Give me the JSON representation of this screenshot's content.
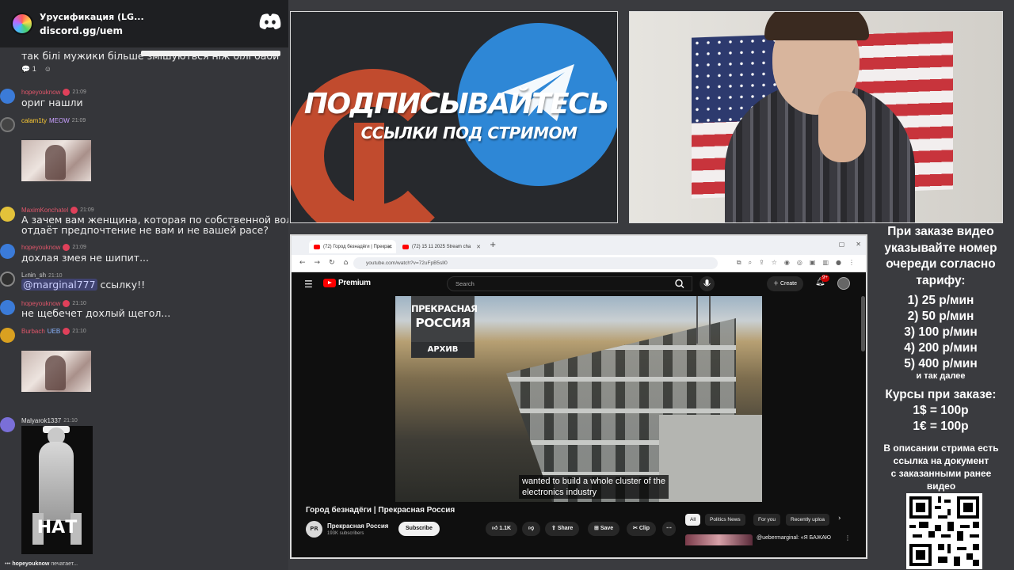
{
  "discord": {
    "server_title": "Урусификация (LG...",
    "invite": "discord.gg/uem"
  },
  "chat": {
    "messages": [
      {
        "text": "так білі мужики більше змішуються ніж білі баби",
        "reactions": [
          {
            "emoji": "speech-bubble",
            "count": "1"
          }
        ]
      },
      {
        "user": "hopeyouknow",
        "time": "21:09",
        "text": "ориг нашли"
      },
      {
        "user": "calam1ty",
        "badge": "MEOW",
        "time": "21:09",
        "image": "woman-photo"
      },
      {
        "user": "MaximKonchatel",
        "time": "21:09",
        "text_line1": "А зачем вам женщина, которая по собственной воле",
        "text_line2": "отдаёт предпочтение не вам и не вашей расе?"
      },
      {
        "user": "hopeyouknow",
        "time": "21:09",
        "text": "дохлая змея не шипит..."
      },
      {
        "user": "L𝔢nin_sh",
        "time": "21:10",
        "mention": "@marginal777",
        "text": " ссылку!!"
      },
      {
        "user": "hopeyouknow",
        "time": "21:10",
        "text": "не щебечет дохлый щегол..."
      },
      {
        "user": "Burbach",
        "badge": "UEB",
        "time": "21:10",
        "image": "woman-photo"
      },
      {
        "user": "Malyarok1337",
        "time": "21:10",
        "gif_caption": "НАТ"
      }
    ],
    "typing_user": "hopeyouknow",
    "typing_text": " печатает..."
  },
  "banner": {
    "title": "ПОДПИСЫВАЙТЕСЬ",
    "subtitle": "ССЫЛКИ ПОД СТРИМОМ"
  },
  "browser": {
    "tabs": [
      {
        "label": "(72) Город безнадёги | Прекрас",
        "active": true
      },
      {
        "label": "(72) 15 11 2025 Stream cha",
        "active": false
      }
    ],
    "url": "youtube.com/watch?v=72uFpB5sll0",
    "youtube": {
      "brand": "Premium",
      "search_placeholder": "Search",
      "create_label": "Create",
      "notifications": "9+",
      "logo_line1": "ПРЕКРАСНАЯ",
      "logo_line2": "РОССИЯ",
      "logo_tag": "АРХИВ",
      "caption_line1": "wanted to build a whole cluster of the",
      "caption_line2": "electronics industry",
      "video_title": "Город безнадёги | Прекрасная Россия",
      "channel_name": "Прекрасная Россия",
      "channel_initials": "PR",
      "channel_subs": "193K subscribers",
      "subscribe_label": "Subscribe",
      "likes": "1.1K",
      "share_label": "Share",
      "save_label": "Save",
      "clip_label": "Clip",
      "chips": [
        "All",
        "Politics News",
        "For you",
        "Recently uploa"
      ],
      "rec_title": "@uebermarginal: «Я БАЖАЮ"
    }
  },
  "prices": {
    "header": [
      "При заказе видео",
      "указывайте номер",
      "очереди согласно",
      "тарифу:"
    ],
    "rates": [
      "1) 25 р/мин",
      "2) 50 р/мин",
      "3) 100 р/мин",
      "4) 200 р/мин",
      "5) 400 р/мин"
    ],
    "etc": "и так далее",
    "rates_title": "Курсы при заказе:",
    "usd": "1$ = 100р",
    "eur": "1€ = 100р",
    "desc": [
      "В описании стрима есть",
      "ссылка на документ",
      "с заказанными ранее",
      "видео"
    ]
  },
  "colors": {
    "username": "#e0566a",
    "telegram_blue": "#2e87d6",
    "rutube_red": "#c14b2e",
    "yt_red": "#ff0000"
  }
}
